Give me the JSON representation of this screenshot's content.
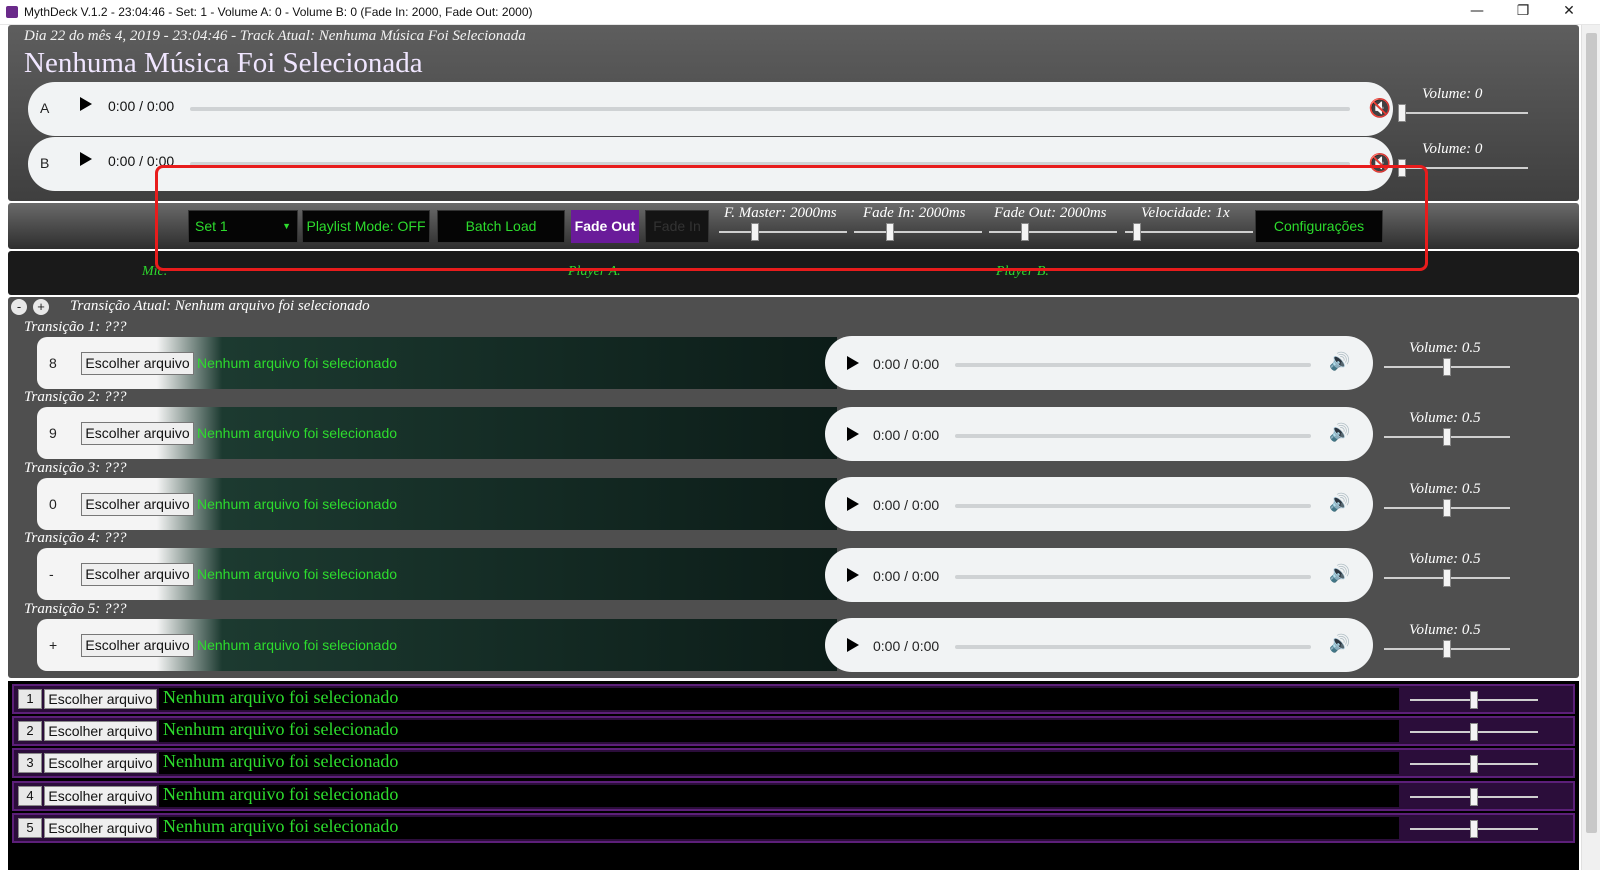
{
  "window": {
    "title": "MythDeck V.1.2 - 23:04:46 - Set: 1 - Volume A: 0 - Volume B: 0 (Fade In: 2000, Fade Out: 2000)",
    "minimize": "—",
    "maximize": "❐",
    "close": "✕"
  },
  "header": {
    "date_line": "Dia 22 do mês 4, 2019 - 23:04:46 - Track Atual: Nenhuma Música Foi Selecionada",
    "title": "Nenhuma Música Foi Selecionada",
    "players": [
      {
        "label": "A",
        "time": "0:00 / 0:00",
        "volume_label": "Volume: 0",
        "volume": 0
      },
      {
        "label": "B",
        "time": "0:00 / 0:00",
        "volume_label": "Volume: 0",
        "volume": 0
      }
    ]
  },
  "controls": {
    "set_select": "Set 1",
    "playlist_mode": "Playlist Mode: OFF",
    "batch_load": "Batch Load",
    "fade_out": "Fade Out",
    "fade_in": "Fade In",
    "f_master": "F. Master: 2000ms",
    "fade_in_label": "Fade In: 2000ms",
    "fade_out_label": "Fade Out: 2000ms",
    "velocidade": "Velocidade: 1x",
    "configuracoes": "Configurações"
  },
  "mixer": {
    "mic": "Mic.",
    "player_a": "Player A.",
    "player_b": "Player B."
  },
  "transitions": {
    "header": "Transição Atual: Nenhum arquivo foi selecionado",
    "collapse": "-",
    "expand": "+",
    "file_button": "Escolher arquivo",
    "items": [
      {
        "label": "Transição 1: ???",
        "key": "8",
        "file": "Nenhum arquivo foi selecionado",
        "time": "0:00 / 0:00",
        "volume_label": "Volume: 0.5",
        "volume": 0.5
      },
      {
        "label": "Transição 2: ???",
        "key": "9",
        "file": "Nenhum arquivo foi selecionado",
        "time": "0:00 / 0:00",
        "volume_label": "Volume: 0.5",
        "volume": 0.5
      },
      {
        "label": "Transição 3: ???",
        "key": "0",
        "file": "Nenhum arquivo foi selecionado",
        "time": "0:00 / 0:00",
        "volume_label": "Volume: 0.5",
        "volume": 0.5
      },
      {
        "label": "Transição 4: ???",
        "key": "-",
        "file": "Nenhum arquivo foi selecionado",
        "time": "0:00 / 0:00",
        "volume_label": "Volume: 0.5",
        "volume": 0.5
      },
      {
        "label": "Transição 5: ???",
        "key": "+",
        "file": "Nenhum arquivo foi selecionado",
        "time": "0:00 / 0:00",
        "volume_label": "Volume: 0.5",
        "volume": 0.5
      }
    ]
  },
  "playlist": {
    "file_button": "Escolher arquivo",
    "items": [
      {
        "num": "1",
        "file": "Nenhum arquivo foi selecionado",
        "volume": 0.5
      },
      {
        "num": "2",
        "file": "Nenhum arquivo foi selecionado",
        "volume": 0.5
      },
      {
        "num": "3",
        "file": "Nenhum arquivo foi selecionado",
        "volume": 0.5
      },
      {
        "num": "4",
        "file": "Nenhum arquivo foi selecionado",
        "volume": 0.5
      },
      {
        "num": "5",
        "file": "Nenhum arquivo foi selecionado",
        "volume": 0.5
      }
    ]
  },
  "colors": {
    "accent_green": "#2ddc2d",
    "accent_purple": "#6a1b9a",
    "highlight_red": "#e81c1c"
  }
}
